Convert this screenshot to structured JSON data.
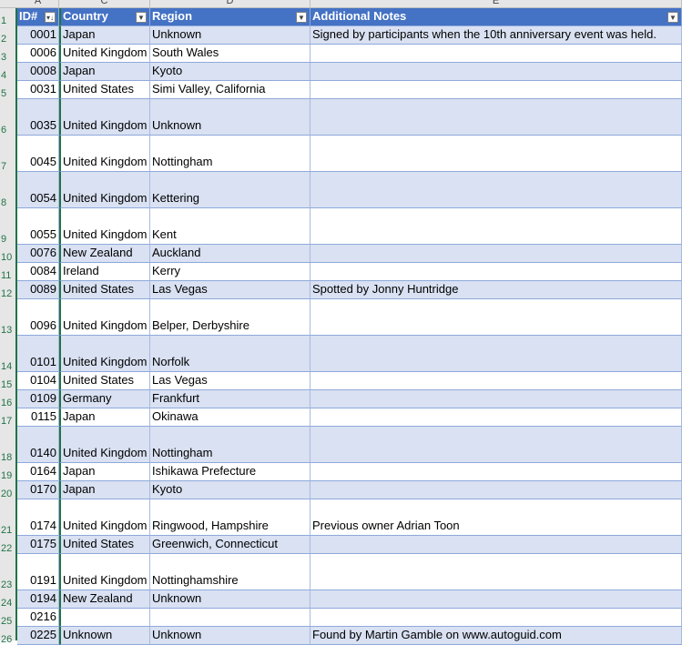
{
  "columns": {
    "letters": [
      "A",
      "C",
      "D",
      "E"
    ],
    "headers": {
      "id": "ID#",
      "country": "Country",
      "region": "Region",
      "notes": "Additional Notes"
    }
  },
  "rows": [
    {
      "n": "2",
      "id": "0001",
      "country": "Japan",
      "region": "Unknown",
      "notes": "Signed by participants when the 10th anniversary event was held."
    },
    {
      "n": "3",
      "id": "0006",
      "country": "United Kingdom",
      "region": "South Wales",
      "notes": ""
    },
    {
      "n": "4",
      "id": "0008",
      "country": "Japan",
      "region": "Kyoto",
      "notes": ""
    },
    {
      "n": "5",
      "id": "0031",
      "country": "United States",
      "region": "Simi Valley, California",
      "notes": ""
    },
    {
      "n": "6",
      "id": "0035",
      "country": "United Kingdom",
      "region": "Unknown",
      "notes": ""
    },
    {
      "n": "7",
      "id": "0045",
      "country": "United Kingdom",
      "region": "Nottingham",
      "notes": ""
    },
    {
      "n": "8",
      "id": "0054",
      "country": "United Kingdom",
      "region": "Kettering",
      "notes": ""
    },
    {
      "n": "9",
      "id": "0055",
      "country": "United Kingdom",
      "region": "Kent",
      "notes": ""
    },
    {
      "n": "10",
      "id": "0076",
      "country": "New Zealand",
      "region": "Auckland",
      "notes": ""
    },
    {
      "n": "11",
      "id": "0084",
      "country": "Ireland",
      "region": "Kerry",
      "notes": ""
    },
    {
      "n": "12",
      "id": "0089",
      "country": "United States",
      "region": "Las Vegas",
      "notes": "Spotted by Jonny Huntridge"
    },
    {
      "n": "13",
      "id": "0096",
      "country": "United Kingdom",
      "region": "Belper, Derbyshire",
      "notes": ""
    },
    {
      "n": "14",
      "id": "0101",
      "country": "United Kingdom",
      "region": "Norfolk",
      "notes": ""
    },
    {
      "n": "15",
      "id": "0104",
      "country": "United States",
      "region": "Las Vegas",
      "notes": ""
    },
    {
      "n": "16",
      "id": "0109",
      "country": "Germany",
      "region": "Frankfurt",
      "notes": ""
    },
    {
      "n": "17",
      "id": "0115",
      "country": "Japan",
      "region": "Okinawa",
      "notes": ""
    },
    {
      "n": "18",
      "id": "0140",
      "country": "United Kingdom",
      "region": "Nottingham",
      "notes": ""
    },
    {
      "n": "19",
      "id": "0164",
      "country": "Japan",
      "region": "Ishikawa Prefecture",
      "notes": ""
    },
    {
      "n": "20",
      "id": "0170",
      "country": "Japan",
      "region": "Kyoto",
      "notes": ""
    },
    {
      "n": "21",
      "id": "0174",
      "country": "United Kingdom",
      "region": "Ringwood, Hampshire",
      "notes": "Previous owner Adrian Toon"
    },
    {
      "n": "22",
      "id": "0175",
      "country": "United States",
      "region": "Greenwich, Connecticut",
      "notes": ""
    },
    {
      "n": "23",
      "id": "0191",
      "country": "United Kingdom",
      "region": "Nottinghamshire",
      "notes": ""
    },
    {
      "n": "24",
      "id": "0194",
      "country": "New Zealand",
      "region": "Unknown",
      "notes": ""
    },
    {
      "n": "25",
      "id": "0216",
      "country": "",
      "region": "",
      "notes": ""
    },
    {
      "n": "26",
      "id": "0225",
      "country": "Unknown",
      "region": "Unknown",
      "notes": "Found by Martin Gamble on www.autoguid.com"
    }
  ]
}
